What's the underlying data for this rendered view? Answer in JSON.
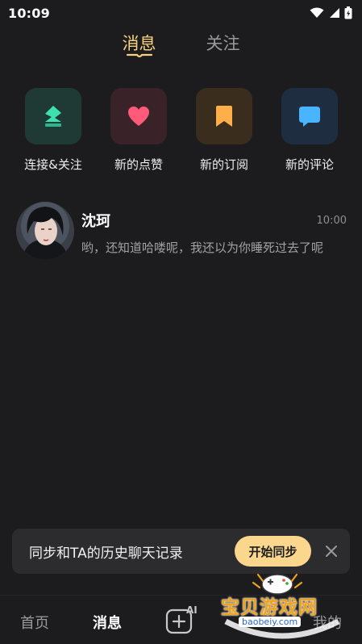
{
  "status_bar": {
    "time": "10:09"
  },
  "top_tabs": [
    {
      "label": "消息",
      "active": true
    },
    {
      "label": "关注",
      "active": false
    }
  ],
  "quick_actions": [
    {
      "label": "连接&关注",
      "icon": "connect-icon",
      "bg": "#1f3a34",
      "color": "#3fe0b0"
    },
    {
      "label": "新的点赞",
      "icon": "heart-icon",
      "bg": "#3a2328",
      "color": "#ff5a7a"
    },
    {
      "label": "新的订阅",
      "icon": "bookmark-icon",
      "bg": "#3a2d1e",
      "color": "#ffae4a"
    },
    {
      "label": "新的评论",
      "icon": "comment-icon",
      "bg": "#1e2e40",
      "color": "#49b4ff"
    }
  ],
  "conversations": [
    {
      "name": "沈珂",
      "time": "10:00",
      "message": "哟，还知道哈喽呢，我还以为你睡死过去了呢"
    }
  ],
  "sync_banner": {
    "text": "同步和TA的历史聊天记录",
    "button": "开始同步"
  },
  "bottom_nav": {
    "home": "首页",
    "messages": "消息",
    "create_badge": "AI",
    "mine": "我的"
  },
  "watermark": {
    "text": "宝贝游戏网",
    "url": "baobeiy.com"
  },
  "colors": {
    "accent": "#f6d27c",
    "background": "#1c1c1e",
    "button": "#fad78c"
  }
}
